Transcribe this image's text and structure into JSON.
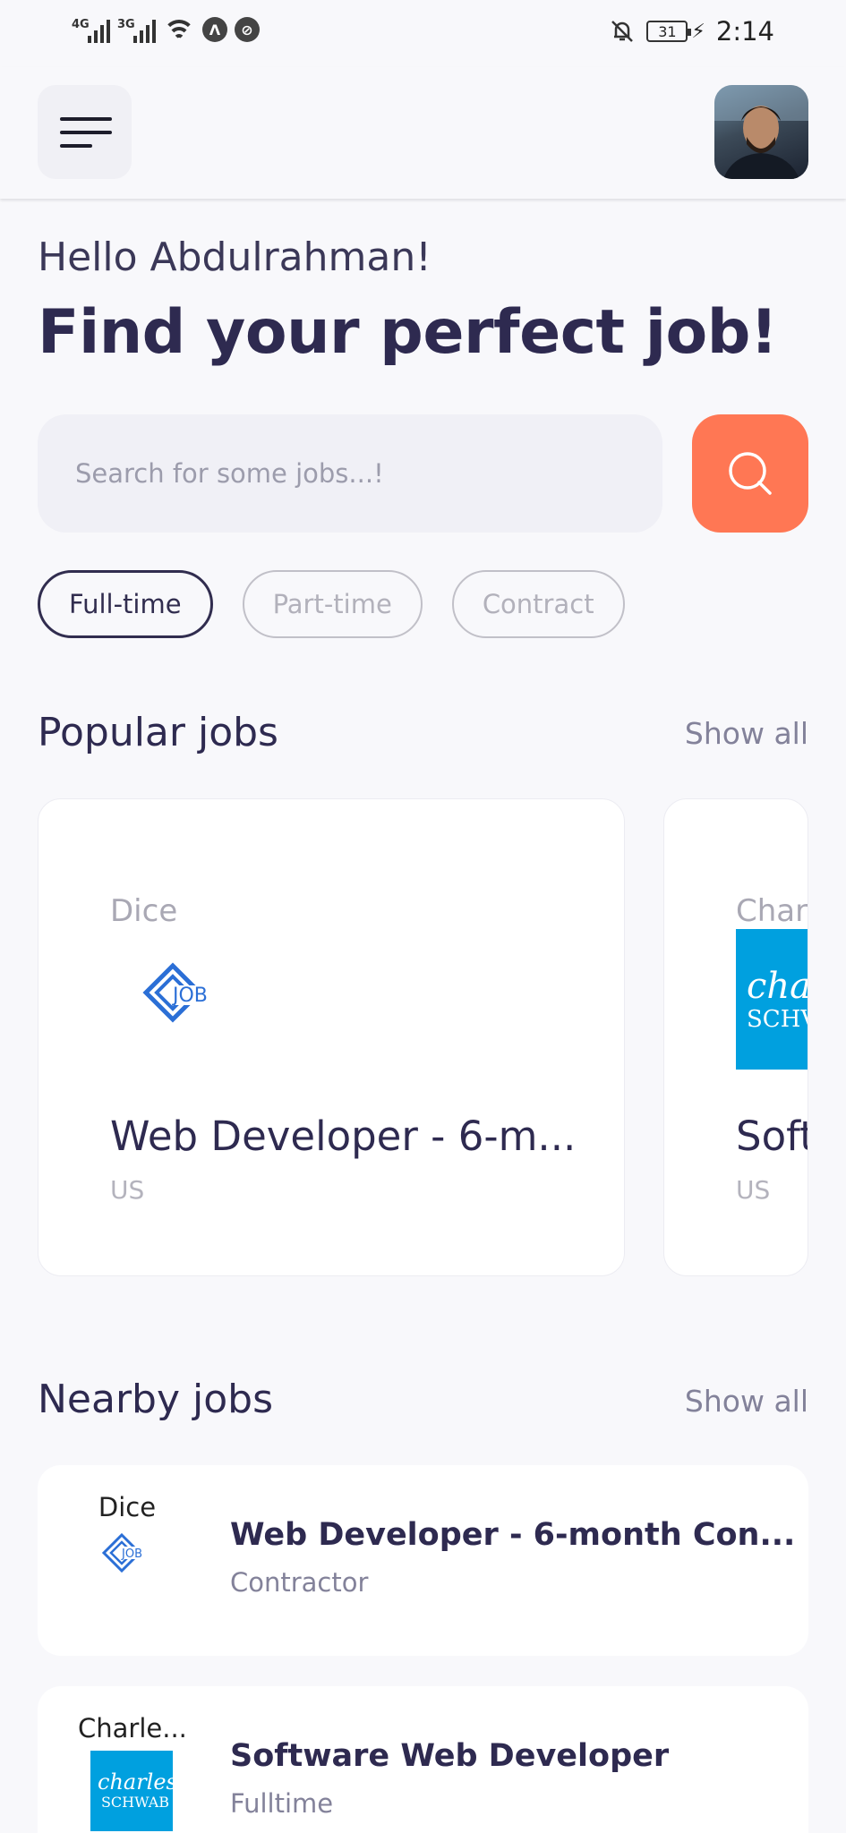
{
  "status_bar": {
    "network_1": "4G",
    "network_2": "3G",
    "battery": "31",
    "time": "2:14"
  },
  "header": {
    "menu_icon": "hamburger-menu-icon",
    "avatar_icon": "user-avatar"
  },
  "greeting": "Hello Abdulrahman!",
  "headline": "Find your perfect job!",
  "search": {
    "placeholder": "Search for some jobs...!",
    "button_icon": "search-icon",
    "button_color": "#ff7754"
  },
  "job_types": [
    {
      "label": "Full-time",
      "selected": true
    },
    {
      "label": "Part-time",
      "selected": false
    },
    {
      "label": "Contract",
      "selected": false
    }
  ],
  "popular": {
    "title": "Popular jobs",
    "show_all": "Show all",
    "cards": [
      {
        "company": "Dice",
        "title": "Web Developer - 6-m...",
        "location": "US",
        "logo": "dice-job-logo"
      },
      {
        "company": "Char",
        "title": "Soft",
        "location": "US",
        "logo": "charles-schwab-logo"
      }
    ]
  },
  "nearby": {
    "title": "Nearby jobs",
    "show_all": "Show all",
    "items": [
      {
        "company": "Dice",
        "title": "Web Developer - 6-month Con...",
        "type": "Contractor",
        "logo": "dice-job-logo"
      },
      {
        "company": "Charle...",
        "title": "Software Web Developer",
        "type": "Fulltime",
        "logo": "charles-schwab-logo"
      }
    ]
  },
  "logo_text": {
    "dice": "JOB",
    "schwab_line1": "charles",
    "schwab_line2": "SCHWAB",
    "schwab_partial_line1": "cha",
    "schwab_partial_line2": "SCHV"
  },
  "colors": {
    "primary_text": "#2e2a50",
    "accent": "#ff7754",
    "schwab_blue": "#00a0df",
    "dice_blue": "#2b6fd6"
  }
}
